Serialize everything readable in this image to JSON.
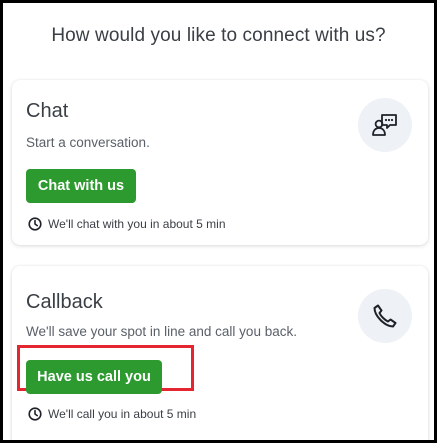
{
  "heading": "How would you like to connect with us?",
  "chat": {
    "title": "Chat",
    "description": "Start a conversation.",
    "button_label": "Chat with us",
    "wait_text": "We'll chat with you in about 5 min",
    "icon": "chat-bubbles-icon"
  },
  "callback": {
    "title": "Callback",
    "description": "We'll save your spot in line and call you back.",
    "button_label": "Have us call you",
    "wait_text": "We'll call you in about 5 min",
    "icon": "phone-icon"
  },
  "colors": {
    "button_green": "#2c9a2e",
    "highlight_red": "#e3262f",
    "icon_bg": "#eef1f5"
  }
}
